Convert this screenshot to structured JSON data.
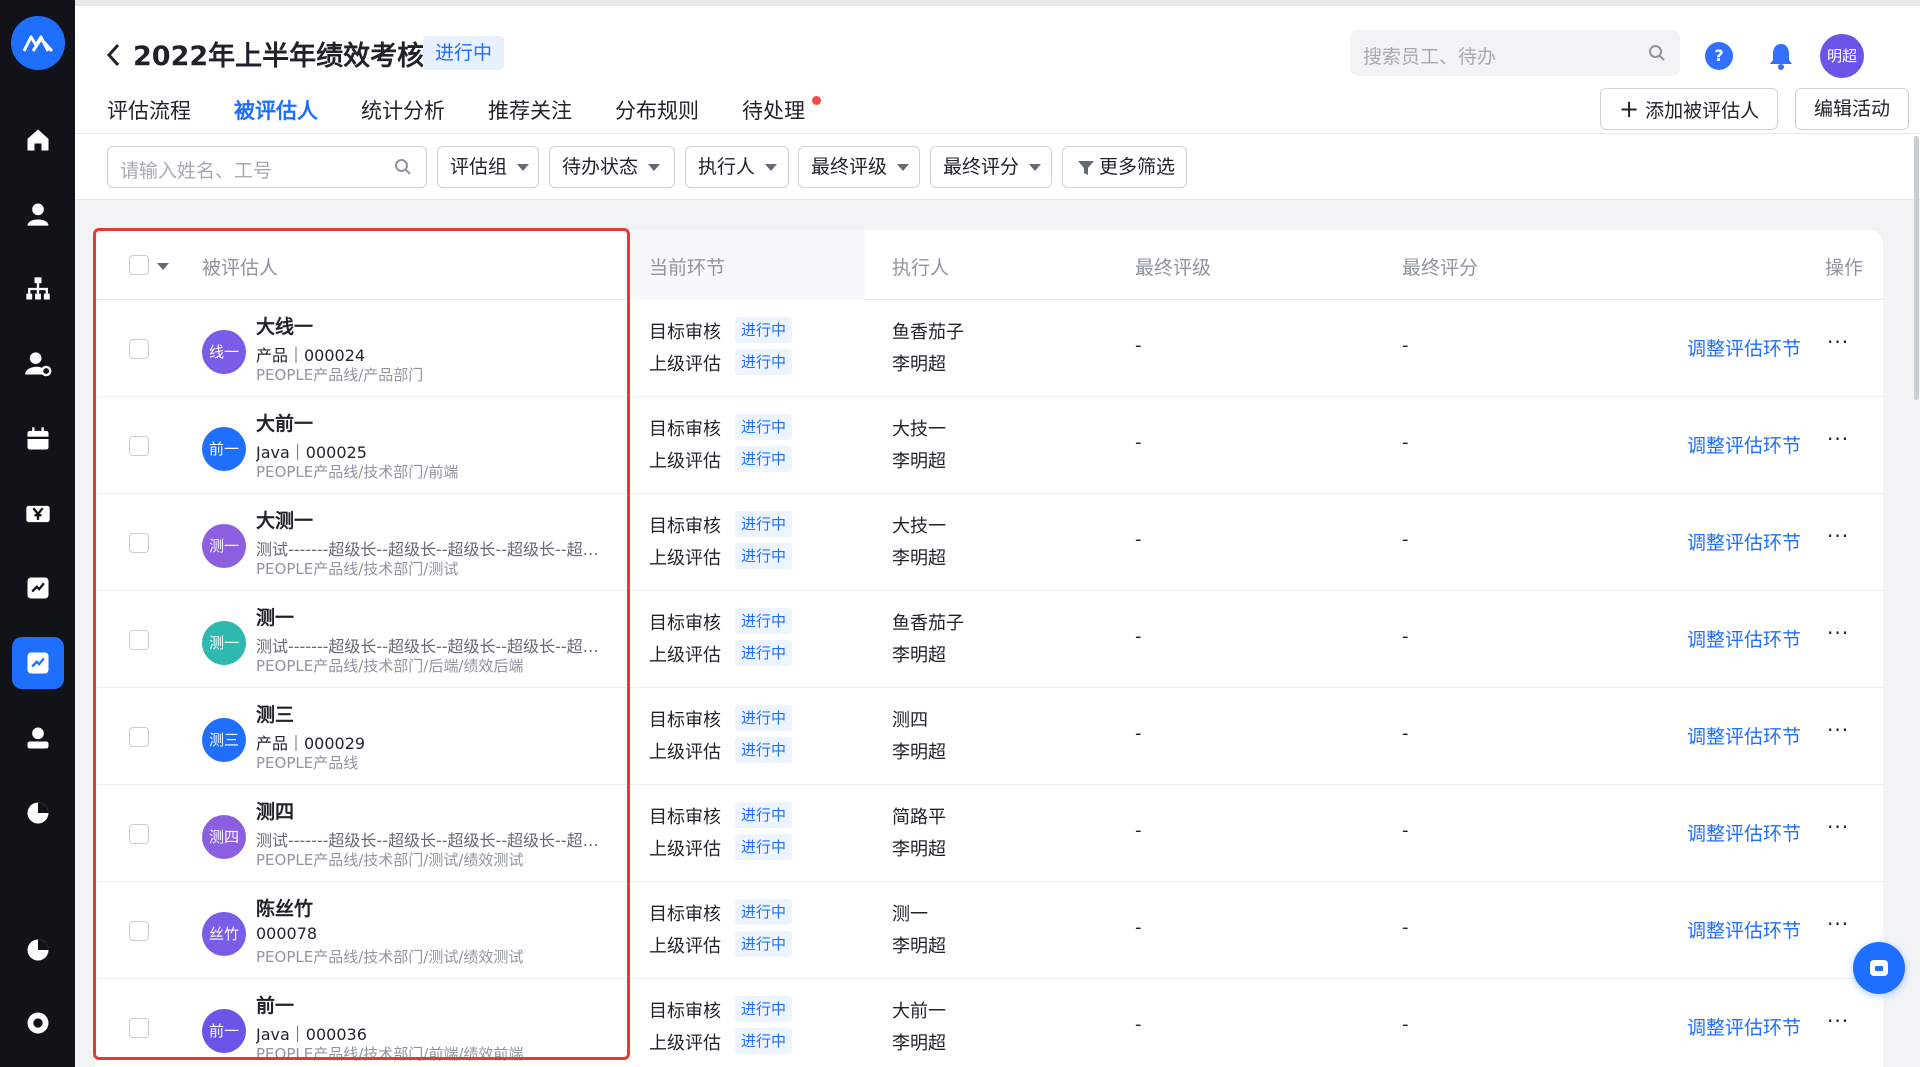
{
  "header": {
    "title": "2022年上半年绩效考核",
    "status": "进行中",
    "search_placeholder": "搜索员工、待办",
    "help_label": "?",
    "user": "明超"
  },
  "tabs": [
    {
      "label": "评估流程"
    },
    {
      "label": "被评估人"
    },
    {
      "label": "统计分析"
    },
    {
      "label": "推荐关注"
    },
    {
      "label": "分布规则"
    },
    {
      "label": "待处理"
    }
  ],
  "actions": {
    "add": "添加被评估人",
    "edit": "编辑活动",
    "more": "···"
  },
  "filters": {
    "search_placeholder": "请输入姓名、工号",
    "chips": [
      "评估组",
      "待办状态",
      "执行人",
      "最终评级",
      "最终评分"
    ],
    "more": "更多筛选"
  },
  "columns": {
    "name": "被评估人",
    "stage": "当前环节",
    "executor": "执行人",
    "grade": "最终评级",
    "score": "最终评分",
    "op": "操作"
  },
  "colors": {
    "accent": "#1f6fff",
    "highlight": "#e53935"
  },
  "rows": [
    {
      "avatar": "线一",
      "avatar_color": "#7b5ce8",
      "name": "大线一",
      "sub": "产品｜000024",
      "sub_gray": false,
      "dept": "PEOPLE产品线/产品部门",
      "stage1": "目标审核",
      "badge1": "进行中",
      "stage2": "上级评估",
      "badge2": "进行中",
      "exec1": "鱼香茄子",
      "exec2": "李明超",
      "grade": "-",
      "score": "-",
      "op": "调整评估环节",
      "more": "···"
    },
    {
      "avatar": "前一",
      "avatar_color": "#1f6fff",
      "name": "大前一",
      "sub": "Java｜000025",
      "sub_gray": false,
      "dept": "PEOPLE产品线/技术部门/前端",
      "stage1": "目标审核",
      "badge1": "进行中",
      "stage2": "上级评估",
      "badge2": "进行中",
      "exec1": "大技一",
      "exec2": "李明超",
      "grade": "-",
      "score": "-",
      "op": "调整评估环节",
      "more": "···"
    },
    {
      "avatar": "测一",
      "avatar_color": "#8b5fe0",
      "name": "大测一",
      "sub": "测试-------超级长--超级长--超级长--超级长--超级长",
      "sub_gray": true,
      "dept": "PEOPLE产品线/技术部门/测试",
      "stage1": "目标审核",
      "badge1": "进行中",
      "stage2": "上级评估",
      "badge2": "进行中",
      "exec1": "大技一",
      "exec2": "李明超",
      "grade": "-",
      "score": "-",
      "op": "调整评估环节",
      "more": "···"
    },
    {
      "avatar": "测一",
      "avatar_color": "#2eb8b0",
      "name": "测一",
      "sub": "测试-------超级长--超级长--超级长--超级长--超级长",
      "sub_gray": true,
      "dept": "PEOPLE产品线/技术部门/后端/绩效后端",
      "stage1": "目标审核",
      "badge1": "进行中",
      "stage2": "上级评估",
      "badge2": "进行中",
      "exec1": "鱼香茄子",
      "exec2": "李明超",
      "grade": "-",
      "score": "-",
      "op": "调整评估环节",
      "more": "···"
    },
    {
      "avatar": "测三",
      "avatar_color": "#1f6fff",
      "name": "测三",
      "sub": "产品｜000029",
      "sub_gray": false,
      "dept": "PEOPLE产品线",
      "stage1": "目标审核",
      "badge1": "进行中",
      "stage2": "上级评估",
      "badge2": "进行中",
      "exec1": "测四",
      "exec2": "李明超",
      "grade": "-",
      "score": "-",
      "op": "调整评估环节",
      "more": "···"
    },
    {
      "avatar": "测四",
      "avatar_color": "#8b5fe0",
      "name": "测四",
      "sub": "测试-------超级长--超级长--超级长--超级长--超级长",
      "sub_gray": true,
      "dept": "PEOPLE产品线/技术部门/测试/绩效测试",
      "stage1": "目标审核",
      "badge1": "进行中",
      "stage2": "上级评估",
      "badge2": "进行中",
      "exec1": "简路平",
      "exec2": "李明超",
      "grade": "-",
      "score": "-",
      "op": "调整评估环节",
      "more": "···"
    },
    {
      "avatar": "丝竹",
      "avatar_color": "#7b5ce8",
      "name": "陈丝竹",
      "sub": "000078",
      "sub_gray": false,
      "dept": "PEOPLE产品线/技术部门/测试/绩效测试",
      "stage1": "目标审核",
      "badge1": "进行中",
      "stage2": "上级评估",
      "badge2": "进行中",
      "exec1": "测一",
      "exec2": "李明超",
      "grade": "-",
      "score": "-",
      "op": "调整评估环节",
      "more": "···"
    },
    {
      "avatar": "前一",
      "avatar_color": "#6a55e8",
      "name": "前一",
      "sub": "Java｜000036",
      "sub_gray": false,
      "dept": "PEOPLE产品线/技术部门/前端/绩效前端",
      "stage1": "目标审核",
      "badge1": "进行中",
      "stage2": "上级评估",
      "badge2": "进行中",
      "exec1": "大前一",
      "exec2": "李明超",
      "grade": "-",
      "score": "-",
      "op": "调整评估环节",
      "more": "···"
    }
  ]
}
